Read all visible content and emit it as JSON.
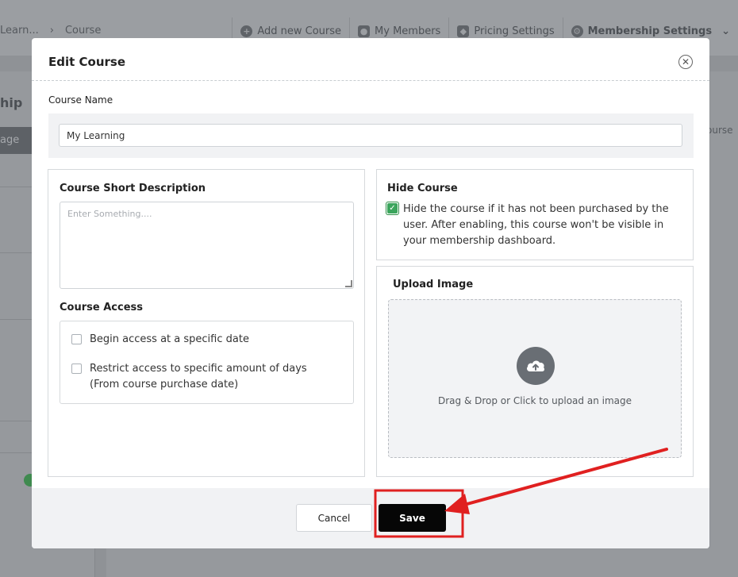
{
  "background": {
    "breadcrumb": [
      "Learn...",
      "Course"
    ],
    "nav": [
      {
        "label": "Add new Course",
        "icon": "plus-circle-icon"
      },
      {
        "label": "My Members",
        "icon": "users-icon"
      },
      {
        "label": "Pricing Settings",
        "icon": "tag-icon"
      },
      {
        "label": "Membership Settings",
        "icon": "gear-icon"
      }
    ],
    "left_title": "hip",
    "left_tab": "age",
    "right_text": "ourse"
  },
  "modal": {
    "title": "Edit Course",
    "course_name": {
      "label": "Course Name",
      "value": "My Learning"
    },
    "short_description": {
      "label": "Course Short Description",
      "placeholder": "Enter Something...."
    },
    "access": {
      "label": "Course Access",
      "options": [
        {
          "label": "Begin access at a specific date",
          "checked": false
        },
        {
          "label": "Restrict access to specific amount of days (From course purchase date)",
          "checked": false
        }
      ]
    },
    "hide_course": {
      "label": "Hide Course",
      "checked": true,
      "description": "Hide the course if it has not been purchased by the user. After enabling, this course won't be visible in your membership dashboard."
    },
    "upload": {
      "label": "Upload Image",
      "hint": "Drag & Drop or Click to upload an image"
    },
    "footer": {
      "cancel_label": "Cancel",
      "save_label": "Save"
    }
  },
  "annotation": {
    "highlight_color": "#e02020",
    "target": "save-button"
  }
}
